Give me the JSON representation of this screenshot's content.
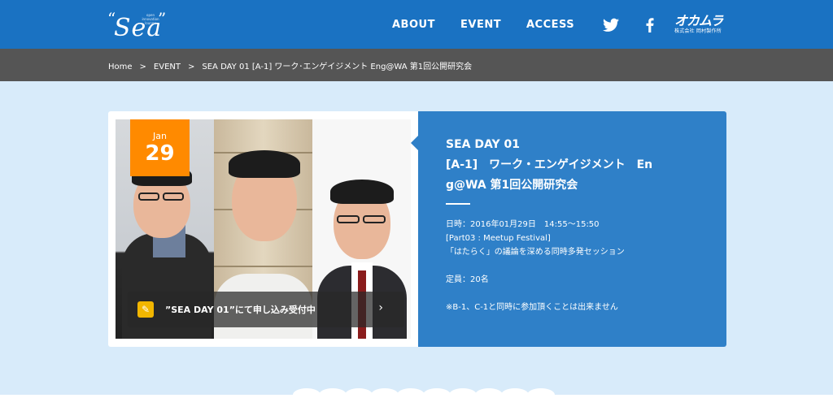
{
  "header": {
    "logo": {
      "quote_open": "“",
      "text": "Sea",
      "quote_close": "”",
      "tagline": "open innovation lounge"
    },
    "nav": [
      "ABOUT",
      "EVENT",
      "ACCESS"
    ],
    "social": [
      "twitter-icon",
      "facebook-icon"
    ],
    "company": {
      "name": "オカムラ",
      "sub": "株式会社 岡村製作所"
    }
  },
  "breadcrumb": [
    "Home",
    "EVENT",
    "SEA DAY 01 [A-1] ワーク･エンゲイジメント Eng@WA 第1回公開研究会"
  ],
  "breadcrumb_sep": ">",
  "event": {
    "date": {
      "month": "Jan",
      "day": "29"
    },
    "cta": {
      "icon": "pencil-icon",
      "text": "”SEA DAY 01”にて申し込み受付中",
      "arrow": "›"
    },
    "title_lines": [
      "SEA DAY 01",
      "[A-1]　ワーク・エンゲイジメント　En",
      "g@WA 第1回公開研究会"
    ],
    "details": [
      "日時：2016年01月29日　14:55〜15:50",
      "[Part03 : Meetup Festival]",
      "「はたらく」の議論を深める同時多発セッション",
      "",
      "定員：20名",
      "",
      "※B-1、C-1と同時に参加頂くことは出来ません"
    ]
  },
  "colors": {
    "header": "#1a72c2",
    "breadcrumb": "#555555",
    "background": "#d8ebfa",
    "info": "#2f80c8",
    "badge": "#ff8a00",
    "cta_icon": "#f2b600"
  }
}
